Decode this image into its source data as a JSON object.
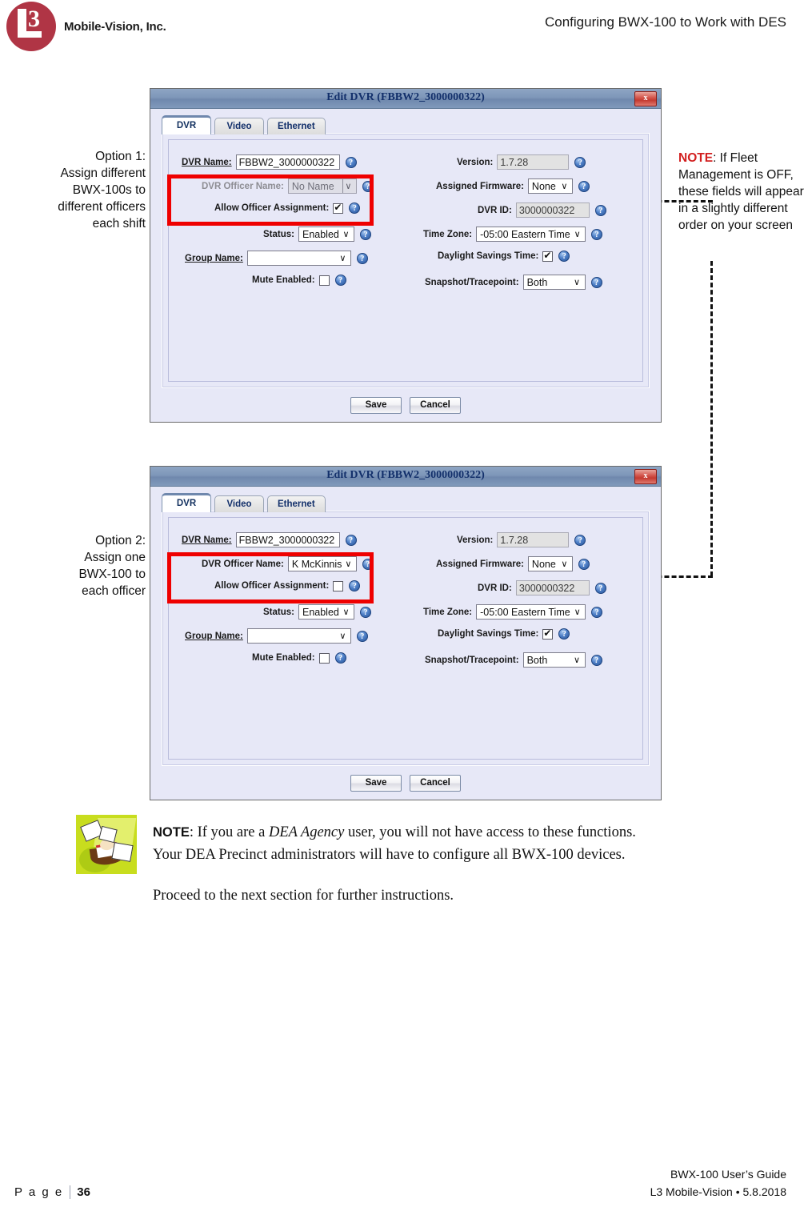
{
  "header": {
    "logo_text": "Mobile-Vision, Inc.",
    "logo_letter": "L",
    "logo_number": "3",
    "title": "Configuring BWX-100 to Work with DES"
  },
  "annotations": {
    "option1": "Option 1:\nAssign different\nBWX-100s to\ndifferent officers\neach shift",
    "option2": "Option 2:\nAssign one\nBWX-100 to\neach officer",
    "note_right_keyword": "NOTE",
    "note_right_body": ": If Fleet Management is OFF, these fields will appear in a slightly different order on your screen"
  },
  "dialog1": {
    "title": "Edit DVR (FBBW2_3000000322)",
    "close_label": "x",
    "tabs": [
      {
        "label": "DVR",
        "active": true
      },
      {
        "label": "Video",
        "active": false
      },
      {
        "label": "Ethernet",
        "active": false
      }
    ],
    "fields": {
      "dvr_name_label": "DVR Name:",
      "dvr_name_value": "FBBW2_3000000322",
      "dvr_officer_name_label": "DVR Officer Name:",
      "dvr_officer_name_value": "No Name",
      "allow_officer_assignment_label": "Allow Officer Assignment:",
      "allow_officer_assignment_checked": true,
      "status_label": "Status:",
      "status_value": "Enabled",
      "group_name_label": "Group Name:",
      "group_name_value": "",
      "mute_enabled_label": "Mute Enabled:",
      "mute_enabled_checked": false,
      "version_label": "Version:",
      "version_value": "1.7.28",
      "assigned_firmware_label": "Assigned Firmware:",
      "assigned_firmware_value": "None",
      "dvr_id_label": "DVR ID:",
      "dvr_id_value": "3000000322",
      "time_zone_label": "Time Zone:",
      "time_zone_value": "-05:00 Eastern Time",
      "daylight_savings_label": "Daylight Savings Time:",
      "daylight_savings_checked": true,
      "snapshot_tracepoint_label": "Snapshot/Tracepoint:",
      "snapshot_tracepoint_value": "Both"
    },
    "buttons": {
      "save": "Save",
      "cancel": "Cancel"
    }
  },
  "dialog2": {
    "title": "Edit DVR (FBBW2_3000000322)",
    "close_label": "x",
    "tabs": [
      {
        "label": "DVR",
        "active": true
      },
      {
        "label": "Video",
        "active": false
      },
      {
        "label": "Ethernet",
        "active": false
      }
    ],
    "fields": {
      "dvr_name_label": "DVR Name:",
      "dvr_name_value": "FBBW2_3000000322",
      "dvr_officer_name_label": "DVR Officer Name:",
      "dvr_officer_name_value": "K McKinnis",
      "allow_officer_assignment_label": "Allow Officer Assignment:",
      "allow_officer_assignment_checked": false,
      "status_label": "Status:",
      "status_value": "Enabled",
      "group_name_label": "Group Name:",
      "group_name_value": "",
      "mute_enabled_label": "Mute Enabled:",
      "mute_enabled_checked": false,
      "version_label": "Version:",
      "version_value": "1.7.28",
      "assigned_firmware_label": "Assigned Firmware:",
      "assigned_firmware_value": "None",
      "dvr_id_label": "DVR ID:",
      "dvr_id_value": "3000000322",
      "time_zone_label": "Time Zone:",
      "time_zone_value": "-05:00 Eastern Time",
      "daylight_savings_label": "Daylight Savings Time:",
      "daylight_savings_checked": true,
      "snapshot_tracepoint_label": "Snapshot/Tracepoint:",
      "snapshot_tracepoint_value": "Both"
    },
    "buttons": {
      "save": "Save",
      "cancel": "Cancel"
    }
  },
  "bottom_note": {
    "keyword": "NOTE",
    "line1_a": ": If you are a ",
    "line1_italic": "DEA Agency",
    "line1_b": " user, you will not have access to these functions.",
    "line2": "Your DEA Precinct administrators will have to configure all BWX-100 devices.",
    "proceed": "Proceed to the next section for further instructions."
  },
  "footer": {
    "page_word": "P a g e",
    "page_number": "36",
    "guide": "BWX-100 User’s Guide",
    "company": "L3 Mobile-Vision • 5.8.2018"
  },
  "colors": {
    "brand_red": "#b03545",
    "highlight_red": "#ef0000",
    "note_red": "#d21f1f",
    "dialog_bg": "#e7e8f7",
    "titlebar_blue": "#7e97b9"
  },
  "icons": {
    "help": "?",
    "caret_down": "∨",
    "check": "✔"
  }
}
